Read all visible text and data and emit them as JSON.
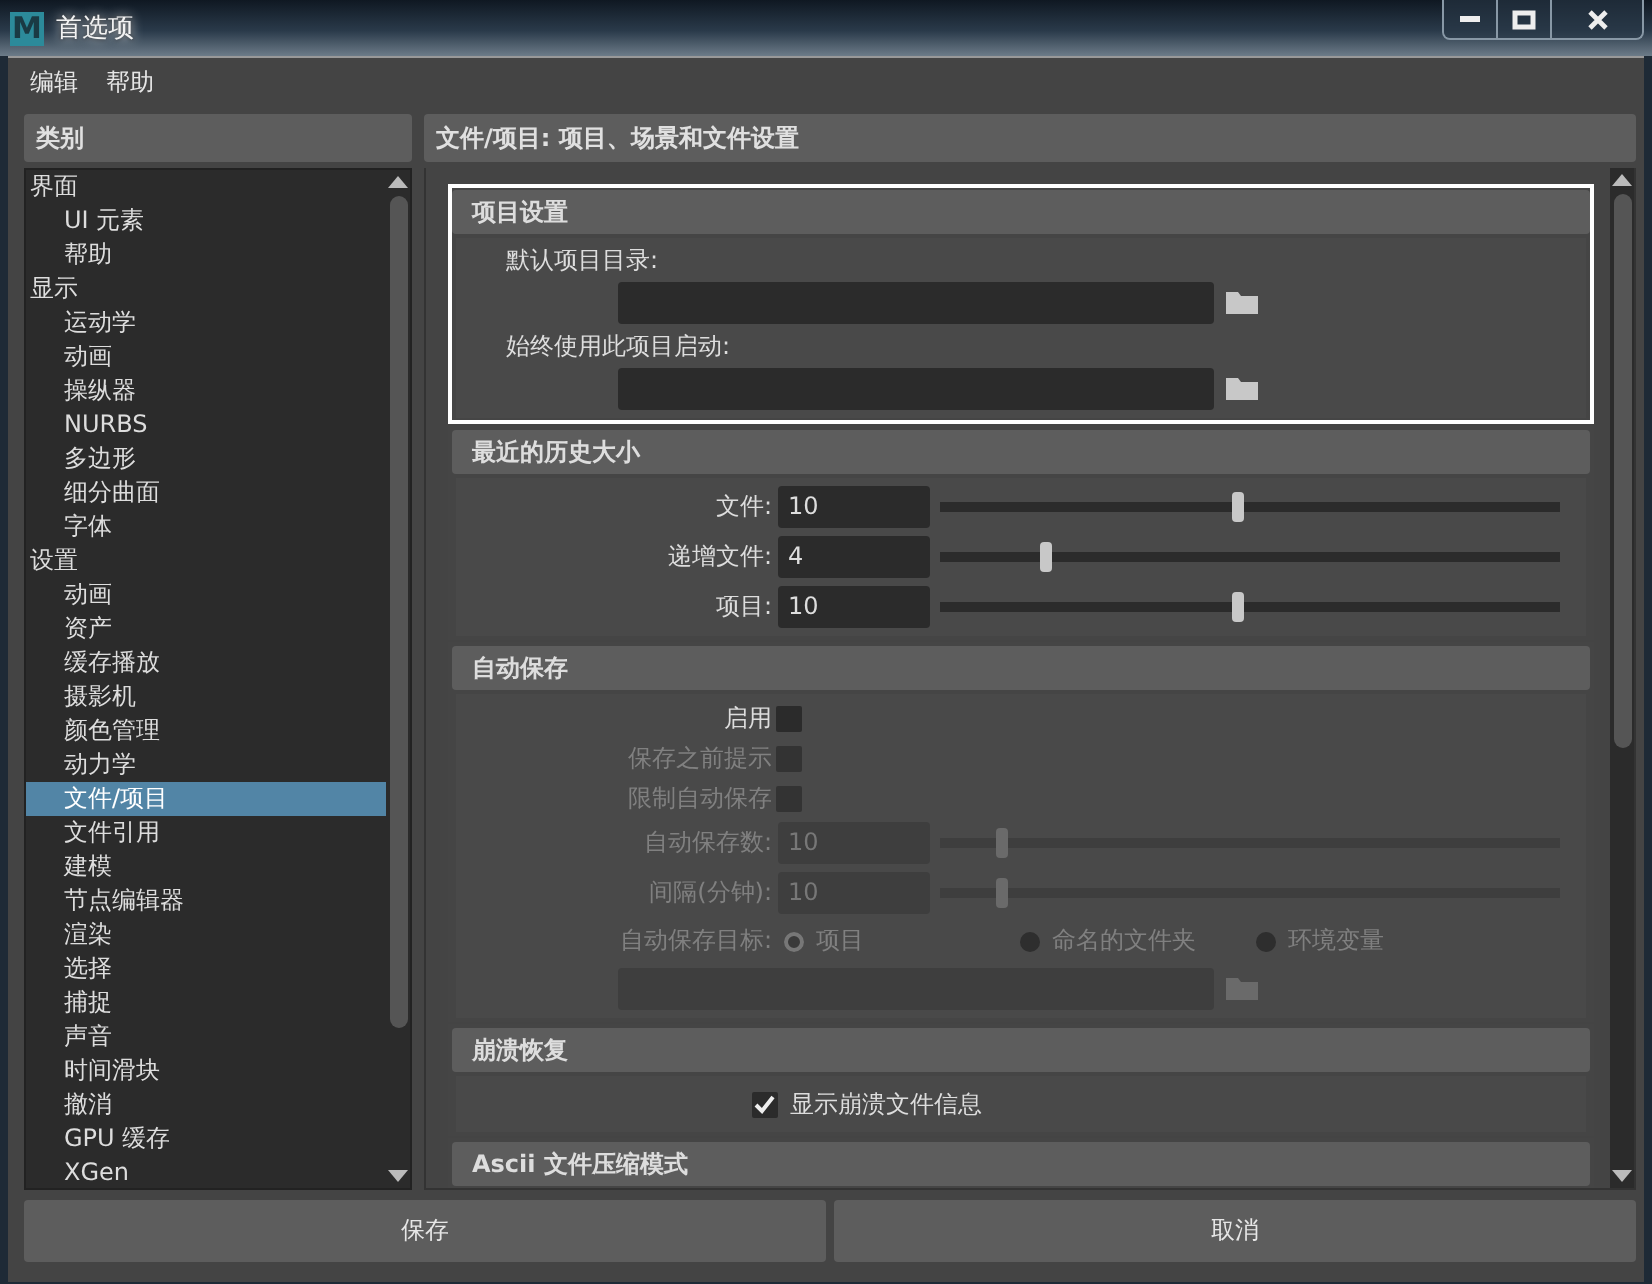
{
  "window": {
    "logo": "M",
    "title": "首选项"
  },
  "menu": [
    "编辑",
    "帮助"
  ],
  "sidebar": {
    "header": "类别",
    "items": [
      {
        "label": "界面",
        "selected": false,
        "children": [
          {
            "label": "UI 元素",
            "selected": false
          },
          {
            "label": "帮助",
            "selected": false
          }
        ]
      },
      {
        "label": "显示",
        "selected": false,
        "children": [
          {
            "label": "运动学",
            "selected": false
          },
          {
            "label": "动画",
            "selected": false
          },
          {
            "label": "操纵器",
            "selected": false
          },
          {
            "label": "NURBS",
            "selected": false
          },
          {
            "label": "多边形",
            "selected": false
          },
          {
            "label": "细分曲面",
            "selected": false
          },
          {
            "label": "字体",
            "selected": false
          }
        ]
      },
      {
        "label": "设置",
        "selected": false,
        "children": [
          {
            "label": "动画",
            "selected": false
          },
          {
            "label": "资产",
            "selected": false
          },
          {
            "label": "缓存播放",
            "selected": false
          },
          {
            "label": "摄影机",
            "selected": false
          },
          {
            "label": "颜色管理",
            "selected": false
          },
          {
            "label": "动力学",
            "selected": false
          },
          {
            "label": "文件/项目",
            "selected": true
          },
          {
            "label": "文件引用",
            "selected": false
          },
          {
            "label": "建模",
            "selected": false
          },
          {
            "label": "节点编辑器",
            "selected": false
          },
          {
            "label": "渲染",
            "selected": false
          },
          {
            "label": "选择",
            "selected": false
          },
          {
            "label": "捕捉",
            "selected": false
          },
          {
            "label": "声音",
            "selected": false
          },
          {
            "label": "时间滑块",
            "selected": false
          },
          {
            "label": "撤消",
            "selected": false
          },
          {
            "label": "GPU 缓存",
            "selected": false
          },
          {
            "label": "XGen",
            "selected": false
          }
        ]
      }
    ]
  },
  "panel": {
    "header": "文件/项目: 项目、场景和文件设置",
    "sections": [
      {
        "title": "项目设置",
        "highlighted": true,
        "rows": [
          {
            "kind": "path",
            "label": "默认项目目录:",
            "disabled": false
          },
          {
            "kind": "path",
            "label": "始终使用此项目启动:",
            "disabled": false
          }
        ]
      },
      {
        "title": "最近的历史大小",
        "highlighted": false,
        "rows": [
          {
            "kind": "slider",
            "label": "文件:",
            "value": "10",
            "level": 0.48,
            "disabled": false
          },
          {
            "kind": "slider",
            "label": "递增文件:",
            "value": "4",
            "level": 0.17,
            "disabled": false
          },
          {
            "kind": "slider",
            "label": "项目:",
            "value": "10",
            "level": 0.48,
            "disabled": false
          }
        ]
      },
      {
        "title": "自动保存",
        "highlighted": false,
        "rows": [
          {
            "kind": "checkbox",
            "label": "启用",
            "checked": false,
            "disabled": false
          },
          {
            "kind": "checkbox",
            "label": "保存之前提示",
            "checked": false,
            "disabled": true
          },
          {
            "kind": "checkbox",
            "label": "限制自动保存",
            "checked": false,
            "disabled": true
          },
          {
            "kind": "slider",
            "label": "自动保存数:",
            "value": "10",
            "level": 0.1,
            "disabled": true
          },
          {
            "kind": "slider",
            "label": "间隔(分钟):",
            "value": "10",
            "level": 0.1,
            "disabled": true
          },
          {
            "kind": "radio",
            "label": "自动保存目标:",
            "disabled": true,
            "options": [
              {
                "label": "项目",
                "selected": true
              },
              {
                "label": "命名的文件夹",
                "selected": false
              },
              {
                "label": "环境变量",
                "selected": false
              }
            ]
          },
          {
            "kind": "path",
            "disabled": true
          }
        ]
      },
      {
        "title": "崩溃恢复",
        "highlighted": false,
        "rows": [
          {
            "kind": "check_inline",
            "label": "显示崩溃文件信息",
            "checked": true,
            "disabled": false
          }
        ]
      },
      {
        "title": "Ascii 文件压缩模式",
        "highlighted": false
      }
    ]
  },
  "buttons": [
    "保存",
    "取消"
  ]
}
